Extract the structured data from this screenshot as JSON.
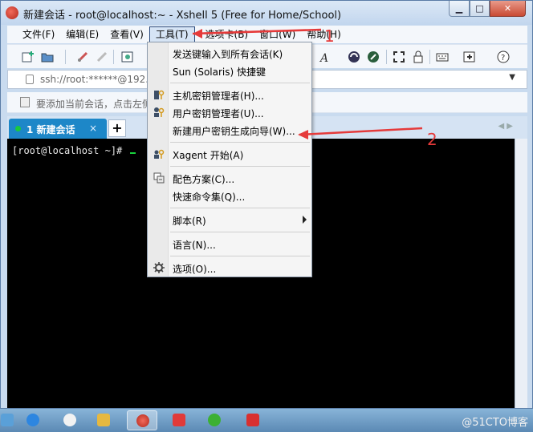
{
  "window": {
    "title": "新建会话 - root@localhost:~ - Xshell 5 (Free for Home/School)",
    "min_glyph": "▁",
    "max_glyph": "□",
    "close_glyph": "✕"
  },
  "menubar": {
    "items": [
      "文件(F)",
      "编辑(E)",
      "查看(V)",
      "工具(T)",
      "选项卡(B)",
      "窗口(W)",
      "帮助(H)"
    ],
    "active_index": 3
  },
  "address": {
    "value": "ssh://root:******@192.1"
  },
  "hint": {
    "text": "要添加当前会话，点击左侧"
  },
  "tab": {
    "label": "1 新建会话",
    "close": "×",
    "add": "+"
  },
  "terminal": {
    "prompt": "[root@localhost ~]# "
  },
  "dropdown": {
    "items": [
      {
        "label": "发送键输入到所有会话(K)",
        "icon": ""
      },
      {
        "label": "Sun (Solaris) 快捷键",
        "icon": ""
      },
      {
        "label": "主机密钥管理者(H)...",
        "icon": "host-key-icon"
      },
      {
        "label": "用户密钥管理者(U)...",
        "icon": "user-key-icon"
      },
      {
        "label": "新建用户密钥生成向导(W)...",
        "icon": ""
      },
      {
        "label": "Xagent 开始(A)",
        "icon": "xagent-icon"
      },
      {
        "label": "配色方案(C)...",
        "icon": "color-scheme-icon"
      },
      {
        "label": "快速命令集(Q)...",
        "icon": ""
      },
      {
        "label": "脚本(R)",
        "icon": ""
      },
      {
        "label": "语言(N)...",
        "icon": ""
      },
      {
        "label": "选项(O)...",
        "icon": "gear-icon"
      }
    ]
  },
  "annotations": {
    "one": "1",
    "two": "2"
  },
  "taskbar": {
    "watermark": "@51CTO博客"
  },
  "colors": {
    "tab_active": "#1d87c8",
    "annotation": "#e53a3a",
    "terminal_bg": "#000000"
  }
}
